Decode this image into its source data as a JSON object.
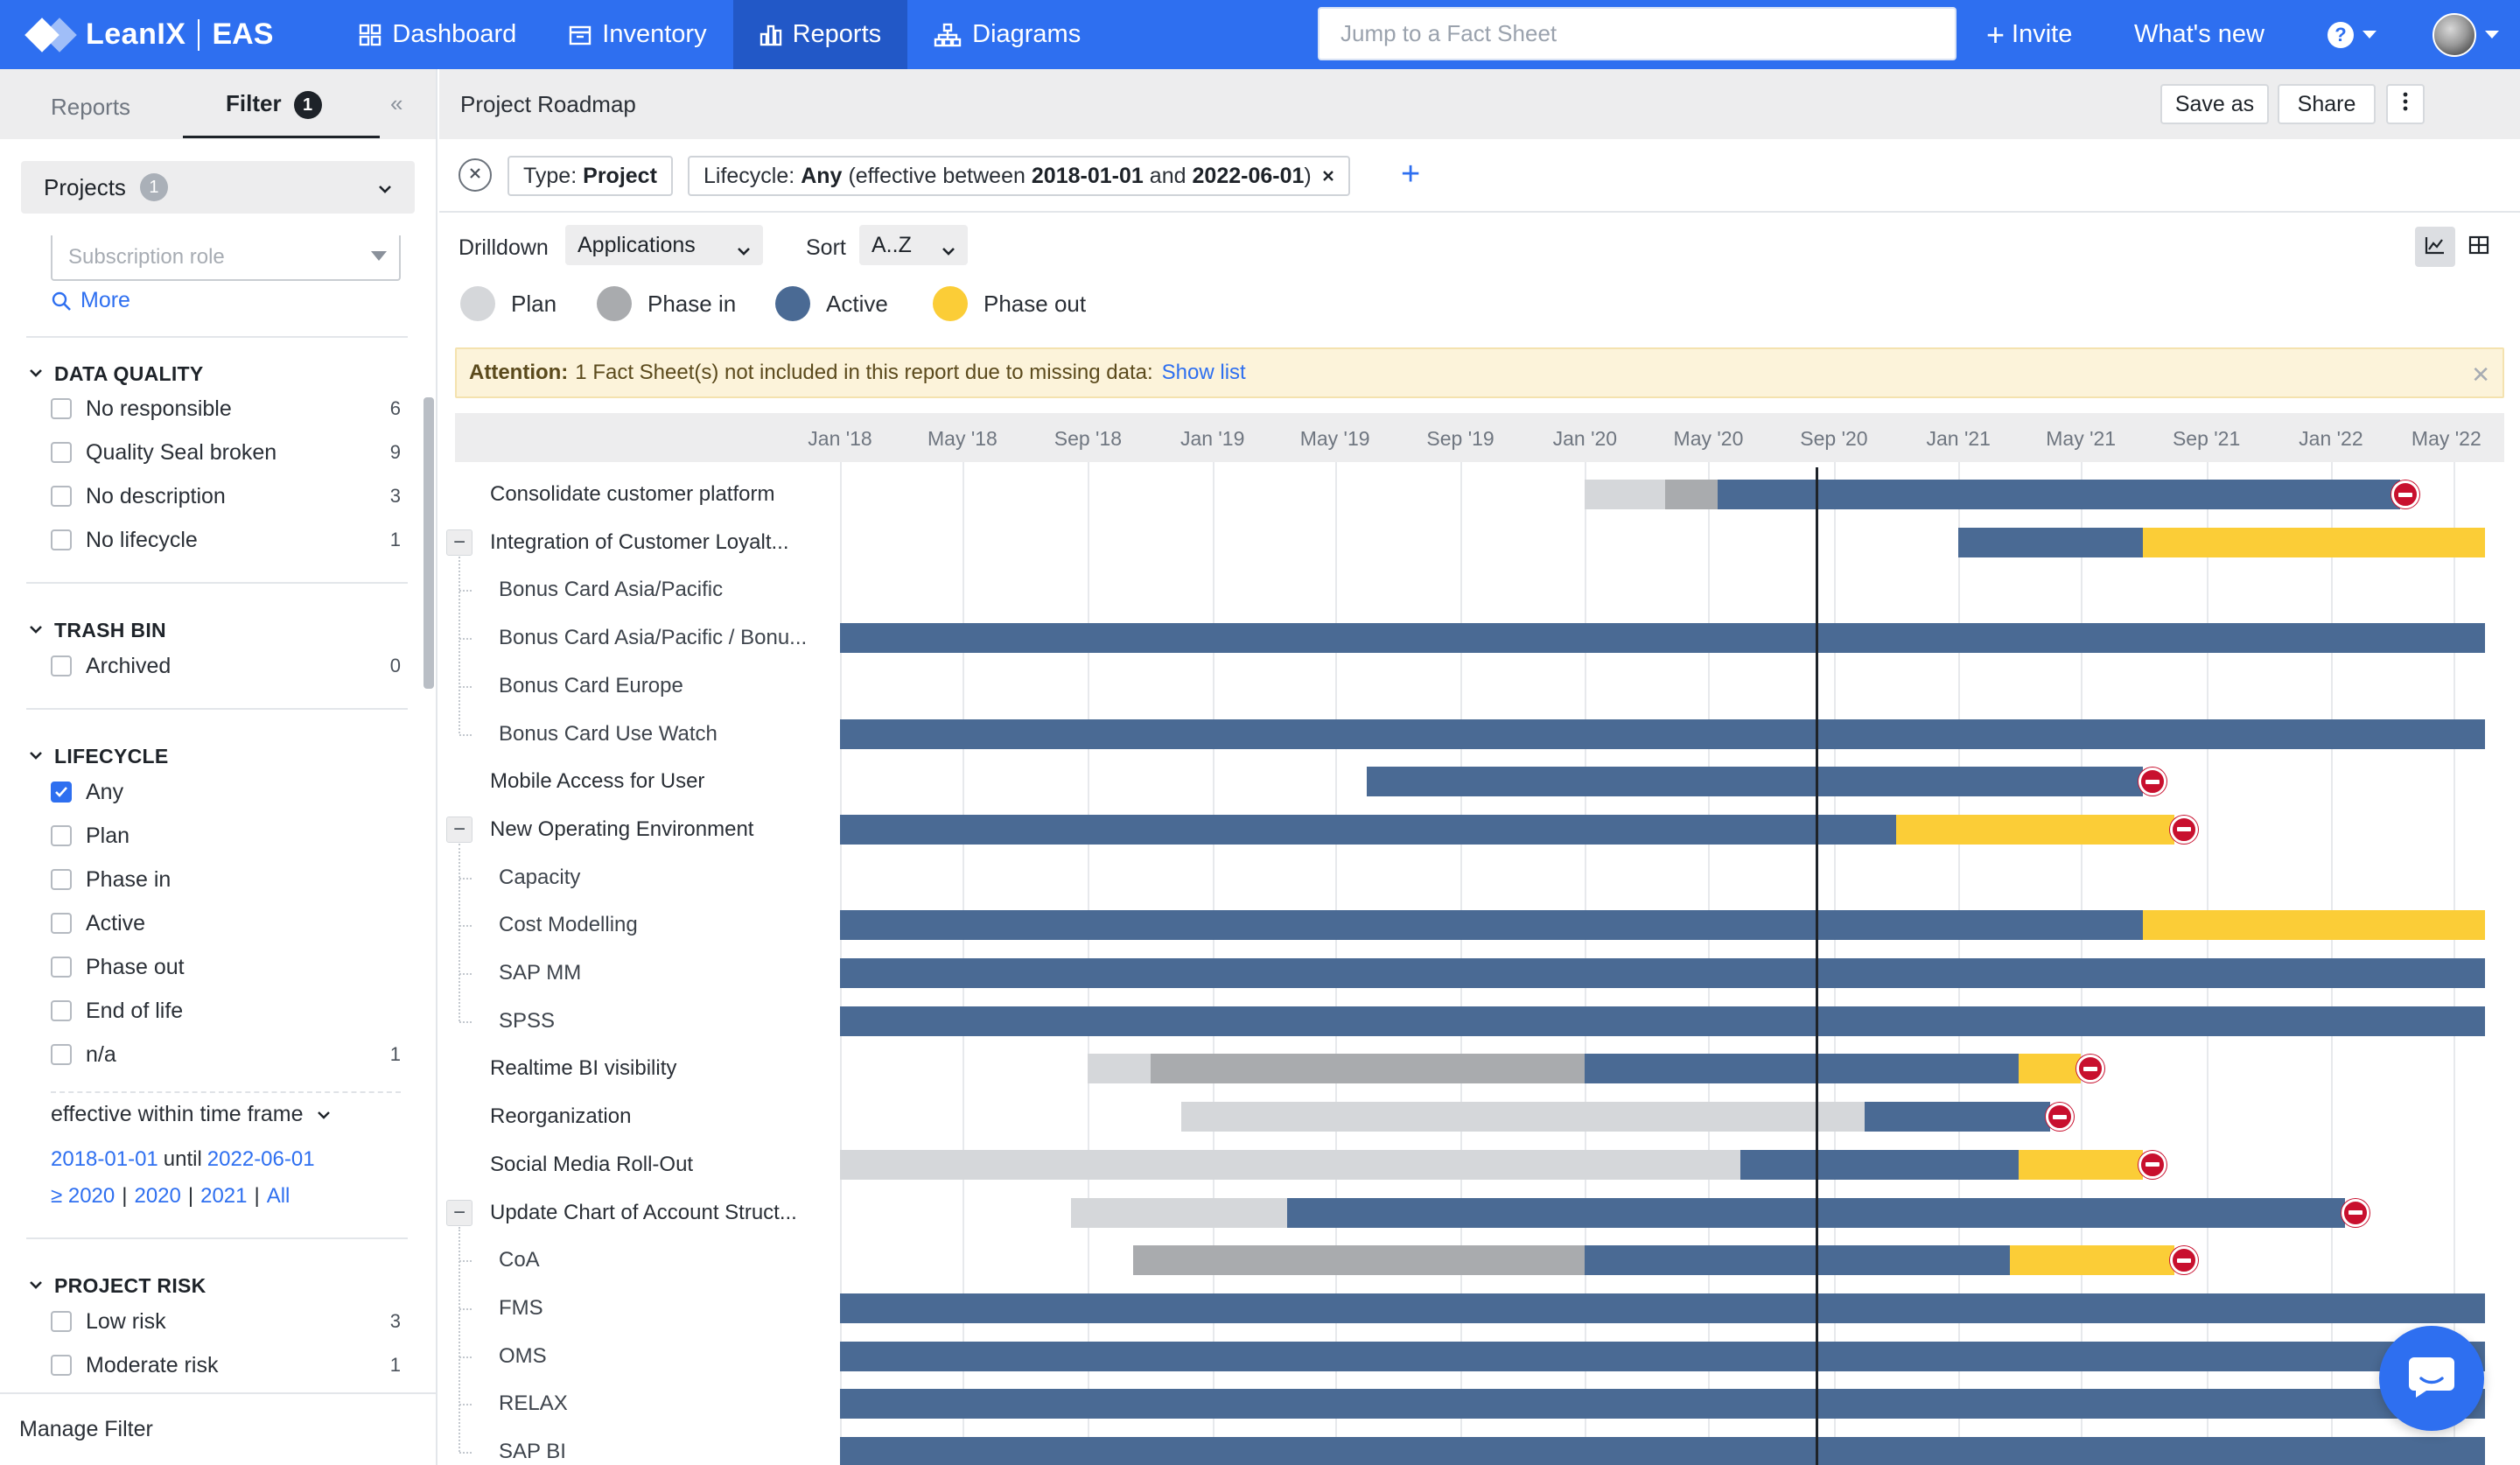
{
  "nav": {
    "logo_text": "LeanIX",
    "logo_sub": "EAS",
    "items": [
      {
        "label": "Dashboard",
        "icon": "grid-icon"
      },
      {
        "label": "Inventory",
        "icon": "inventory-icon"
      },
      {
        "label": "Reports",
        "icon": "reports-icon"
      },
      {
        "label": "Diagrams",
        "icon": "diagrams-icon"
      }
    ],
    "search_placeholder": "Jump to a Fact Sheet",
    "invite": "Invite",
    "whats_new": "What's new"
  },
  "sidebar": {
    "tab_reports": "Reports",
    "tab_filter": "Filter",
    "filter_count": "1",
    "project_select": "Projects",
    "project_count": "1",
    "subscription_role_placeholder": "Subscription role",
    "more": "More",
    "sections": {
      "data_quality": {
        "title": "DATA QUALITY",
        "items": [
          {
            "label": "No responsible",
            "count": "6"
          },
          {
            "label": "Quality Seal broken",
            "count": "9"
          },
          {
            "label": "No description",
            "count": "3"
          },
          {
            "label": "No lifecycle",
            "count": "1"
          }
        ]
      },
      "trash_bin": {
        "title": "TRASH BIN",
        "items": [
          {
            "label": "Archived",
            "count": "0"
          }
        ]
      },
      "lifecycle": {
        "title": "LIFECYCLE",
        "items": [
          {
            "label": "Any",
            "count": "",
            "checked": true
          },
          {
            "label": "Plan",
            "count": ""
          },
          {
            "label": "Phase in",
            "count": ""
          },
          {
            "label": "Active",
            "count": ""
          },
          {
            "label": "Phase out",
            "count": ""
          },
          {
            "label": "End of life",
            "count": ""
          },
          {
            "label": "n/a",
            "count": "1"
          }
        ],
        "timeframe_label": "effective within time frame",
        "from": "2018-01-01",
        "until_word": "until",
        "to": "2022-06-01",
        "quick": [
          "≥ 2020",
          "2020",
          "2021",
          "All"
        ]
      },
      "project_risk": {
        "title": "PROJECT RISK",
        "items": [
          {
            "label": "Low risk",
            "count": "3"
          },
          {
            "label": "Moderate risk",
            "count": "1"
          }
        ]
      }
    },
    "manage_filter": "Manage Filter"
  },
  "main": {
    "title": "Project Roadmap",
    "save_as": "Save as",
    "share": "Share",
    "chips": {
      "type_label": "Type:",
      "type_value": "Project",
      "lifecycle_label": "Lifecycle:",
      "lifecycle_value": "Any",
      "lifecycle_rest_1": "(effective between",
      "lifecycle_from": "2018-01-01",
      "lifecycle_and": "and",
      "lifecycle_to": "2022-06-01",
      "lifecycle_rest_2": ")"
    },
    "drilldown_label": "Drilldown",
    "drilldown_value": "Applications",
    "sort_label": "Sort",
    "sort_value": "A..Z",
    "legend": [
      {
        "label": "Plan",
        "color": "#d5d7da"
      },
      {
        "label": "Phase in",
        "color": "#a9abae"
      },
      {
        "label": "Active",
        "color": "#4a6a94"
      },
      {
        "label": "Phase out",
        "color": "#fbcd37"
      }
    ],
    "attention": {
      "strong": "Attention:",
      "text": "1 Fact Sheet(s) not included in this report due to missing data:",
      "link": "Show list"
    }
  },
  "gantt": {
    "start": "2018-01-01",
    "end": "2022-06-01",
    "today": "2020-08-15",
    "ticks": [
      "Jan '18",
      "May '18",
      "Sep '18",
      "Jan '19",
      "May '19",
      "Sep '19",
      "Jan '20",
      "May '20",
      "Sep '20",
      "Jan '21",
      "May '21",
      "Sep '21",
      "Jan '22",
      "May '22"
    ],
    "colors": {
      "plan": "#d5d7da",
      "phasein": "#a9abae",
      "active": "#4a6a94",
      "phaseout": "#fbcd37"
    },
    "rows": [
      {
        "label": "Consolidate customer platform",
        "level": 0,
        "segments": [
          [
            "plan",
            "2020-01-01",
            "2020-03-20"
          ],
          [
            "phasein",
            "2020-03-20",
            "2020-05-10"
          ],
          [
            "active",
            "2020-05-10",
            "2022-03-10"
          ]
        ],
        "eol": "2022-03-15"
      },
      {
        "label": "Integration of Customer Loyalt...",
        "level": 0,
        "expandable": true,
        "segments": [
          [
            "active",
            "2021-01-01",
            "2021-07-01"
          ],
          [
            "phaseout",
            "2021-07-01",
            "2022-06-01"
          ]
        ]
      },
      {
        "label": "Bonus Card Asia/Pacific",
        "level": 1,
        "segments": []
      },
      {
        "label": "Bonus Card Asia/Pacific / Bonu...",
        "level": 1,
        "segments": [
          [
            "active",
            "2018-01-01",
            "2022-06-01"
          ]
        ]
      },
      {
        "label": "Bonus Card Europe",
        "level": 1,
        "segments": []
      },
      {
        "label": "Bonus Card Use Watch",
        "level": 1,
        "segments": [
          [
            "active",
            "2018-01-01",
            "2022-06-01"
          ]
        ]
      },
      {
        "label": "Mobile Access for User",
        "level": 0,
        "segments": [
          [
            "active",
            "2019-06-01",
            "2021-07-01"
          ]
        ],
        "eol": "2021-07-10"
      },
      {
        "label": "New Operating Environment",
        "level": 0,
        "expandable": true,
        "segments": [
          [
            "active",
            "2018-01-01",
            "2020-11-01"
          ],
          [
            "phaseout",
            "2020-11-01",
            "2021-08-01"
          ]
        ],
        "eol": "2021-08-10"
      },
      {
        "label": "Capacity",
        "level": 1,
        "segments": []
      },
      {
        "label": "Cost Modelling",
        "level": 1,
        "segments": [
          [
            "active",
            "2018-01-01",
            "2021-07-01"
          ],
          [
            "phaseout",
            "2021-07-01",
            "2022-06-01"
          ]
        ]
      },
      {
        "label": "SAP MM",
        "level": 1,
        "segments": [
          [
            "active",
            "2018-01-01",
            "2022-06-01"
          ]
        ]
      },
      {
        "label": "SPSS",
        "level": 1,
        "segments": [
          [
            "active",
            "2018-01-01",
            "2022-06-01"
          ]
        ]
      },
      {
        "label": "Realtime BI visibility",
        "level": 0,
        "segments": [
          [
            "plan",
            "2018-09-01",
            "2018-11-01"
          ],
          [
            "phasein",
            "2018-11-01",
            "2020-01-01"
          ],
          [
            "active",
            "2020-01-01",
            "2021-03-01"
          ],
          [
            "phaseout",
            "2021-03-01",
            "2021-05-01"
          ]
        ],
        "eol": "2021-05-10"
      },
      {
        "label": "Reorganization",
        "level": 0,
        "segments": [
          [
            "plan",
            "2018-12-01",
            "2020-10-01"
          ],
          [
            "active",
            "2020-10-01",
            "2021-04-01"
          ]
        ],
        "eol": "2021-04-10"
      },
      {
        "label": "Social Media Roll-Out",
        "level": 0,
        "segments": [
          [
            "plan",
            "2018-01-01",
            "2020-06-01"
          ],
          [
            "active",
            "2020-06-01",
            "2021-03-01"
          ],
          [
            "phaseout",
            "2021-03-01",
            "2021-07-01"
          ]
        ],
        "eol": "2021-07-10"
      },
      {
        "label": "Update Chart of Account Struct...",
        "level": 0,
        "expandable": true,
        "segments": [
          [
            "plan",
            "2018-08-15",
            "2019-03-15"
          ],
          [
            "active",
            "2019-03-15",
            "2022-01-15"
          ]
        ],
        "eol": "2022-01-25"
      },
      {
        "label": "CoA",
        "level": 1,
        "segments": [
          [
            "phasein",
            "2018-10-15",
            "2020-01-01"
          ],
          [
            "active",
            "2020-01-01",
            "2021-02-20"
          ],
          [
            "phaseout",
            "2021-02-20",
            "2021-08-01"
          ]
        ],
        "eol": "2021-08-10"
      },
      {
        "label": "FMS",
        "level": 1,
        "segments": [
          [
            "active",
            "2018-01-01",
            "2022-06-01"
          ]
        ]
      },
      {
        "label": "OMS",
        "level": 1,
        "segments": [
          [
            "active",
            "2018-01-01",
            "2022-06-01"
          ]
        ]
      },
      {
        "label": "RELAX",
        "level": 1,
        "segments": [
          [
            "active",
            "2018-01-01",
            "2022-06-01"
          ]
        ]
      },
      {
        "label": "SAP BI",
        "level": 1,
        "segments": [
          [
            "active",
            "2018-01-01",
            "2022-06-01"
          ]
        ]
      }
    ]
  }
}
